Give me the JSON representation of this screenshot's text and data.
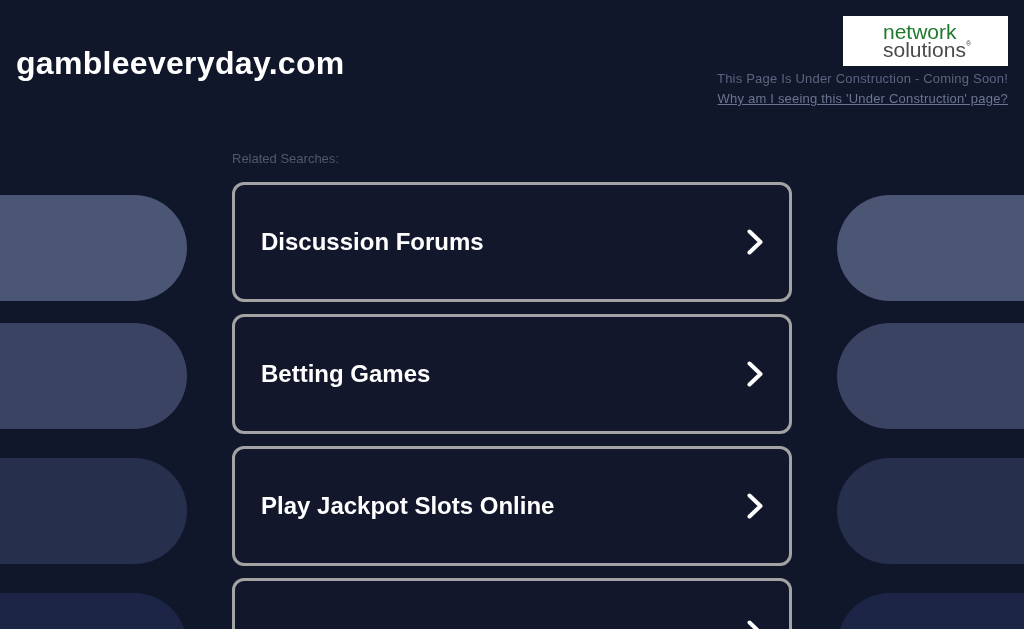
{
  "header": {
    "domain": "gambleeveryday.com",
    "logo": {
      "line_1": "network",
      "line_2": "solutions$^{®}$"
    },
    "notice": "This Page Is Under Construction - Coming Soon!",
    "link": "Why am I seeing this 'Under Construction' page?"
  },
  "related_searches": {
    "heading": "Related Searches:",
    "links": [
      {
        "label": "Discussion Forums"
      },
      {
        "label": "Betting Games"
      },
      {
        "label": "Play Jackpot Slots Online"
      }
    ],
    "more_links_below": true
  }
}
